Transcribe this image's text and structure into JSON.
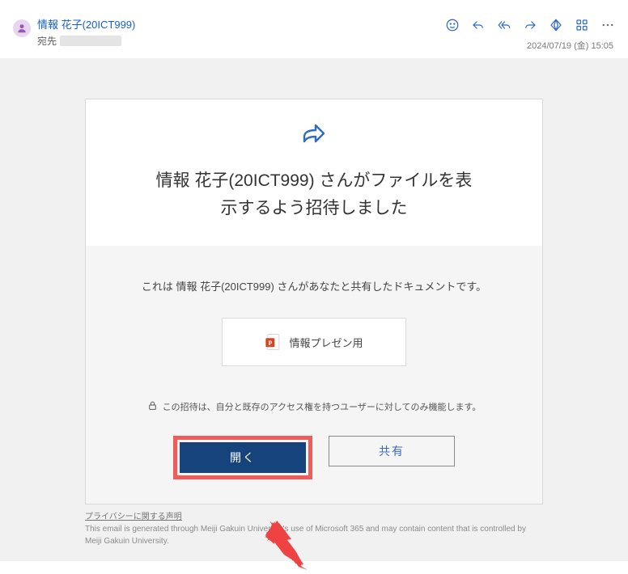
{
  "header": {
    "sender_name": "情報 花子(20ICT999)",
    "recipient_label": "宛先",
    "timestamp": "2024/07/19 (金) 15:05"
  },
  "card": {
    "invite_title_line1": "情報 花子(20ICT999) さんがファイルを表",
    "invite_title_line2": "示するよう招待しました",
    "body_desc": "これは 情報 花子(20ICT999) さんがあなたと共有したドキュメントです。",
    "file_name": "情報プレゼン用",
    "lock_note": "この招待は、自分と既存のアクセス権を持つユーザーに対してのみ機能します。",
    "open_label": "開く",
    "share_label": "共有"
  },
  "footer": {
    "privacy_link": "プライバシーに関する声明",
    "text": "This email is generated through Meiji Gakuin University's use of Microsoft 365 and may contain content that is controlled by Meiji Gakuin University."
  }
}
